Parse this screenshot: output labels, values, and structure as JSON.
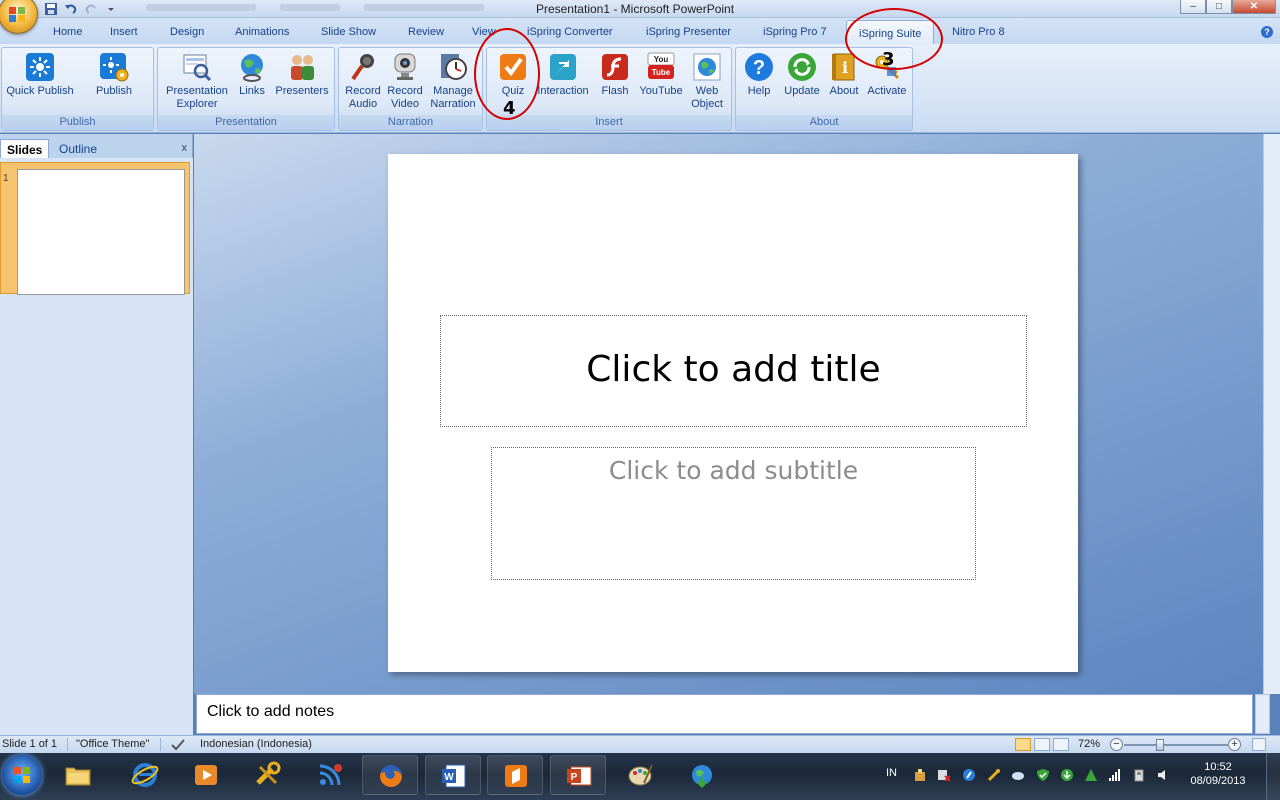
{
  "window": {
    "title": "Presentation1 - Microsoft PowerPoint",
    "controls": [
      "–",
      "□",
      "✕"
    ]
  },
  "tabs": [
    {
      "label": "Home"
    },
    {
      "label": "Insert"
    },
    {
      "label": "Design"
    },
    {
      "label": "Animations"
    },
    {
      "label": "Slide Show"
    },
    {
      "label": "Review"
    },
    {
      "label": "View"
    },
    {
      "label": "iSpring Converter"
    },
    {
      "label": "iSpring Presenter"
    },
    {
      "label": "iSpring Pro 7"
    },
    {
      "label": "iSpring Suite"
    },
    {
      "label": "Nitro Pro 8"
    }
  ],
  "active_tab": "iSpring Suite",
  "ribbon": {
    "groups": {
      "publish": "Publish",
      "presentation": "Presentation",
      "narration": "Narration",
      "insert": "Insert",
      "about": "About"
    },
    "buttons": {
      "quick_publish": "Quick Publish",
      "publish": "Publish",
      "presentation_explorer": "Presentation\nExplorer",
      "links": "Links",
      "presenters": "Presenters",
      "record_audio": "Record\nAudio",
      "record_video": "Record\nVideo",
      "manage_narration": "Manage\nNarration",
      "quiz": "Quiz",
      "interaction": "Interaction",
      "flash": "Flash",
      "youtube": "YouTube",
      "web_object": "Web\nObject",
      "help": "Help",
      "update": "Update",
      "about": "About",
      "activate": "Activate"
    }
  },
  "annotations": {
    "tab_marker": "3",
    "quiz_marker": "4"
  },
  "left_pane": {
    "tab_slides": "Slides",
    "tab_outline": "Outline",
    "close": "x",
    "slide_number": "1"
  },
  "slide": {
    "title_placeholder": "Click to add title",
    "subtitle_placeholder": "Click to add subtitle"
  },
  "notes": {
    "placeholder": "Click to add notes"
  },
  "statusbar": {
    "slide_info": "Slide 1 of 1",
    "theme": "\"Office Theme\"",
    "language": "Indonesian (Indonesia)",
    "zoom": "72%",
    "zoom_minus": "−",
    "zoom_plus": "+"
  },
  "taskbar": {
    "language": "IN",
    "time": "10:52",
    "date": "08/09/2013"
  },
  "colors": {
    "accent": "#15428b",
    "annotation": "#d40000",
    "selection": "#f6c46e"
  }
}
